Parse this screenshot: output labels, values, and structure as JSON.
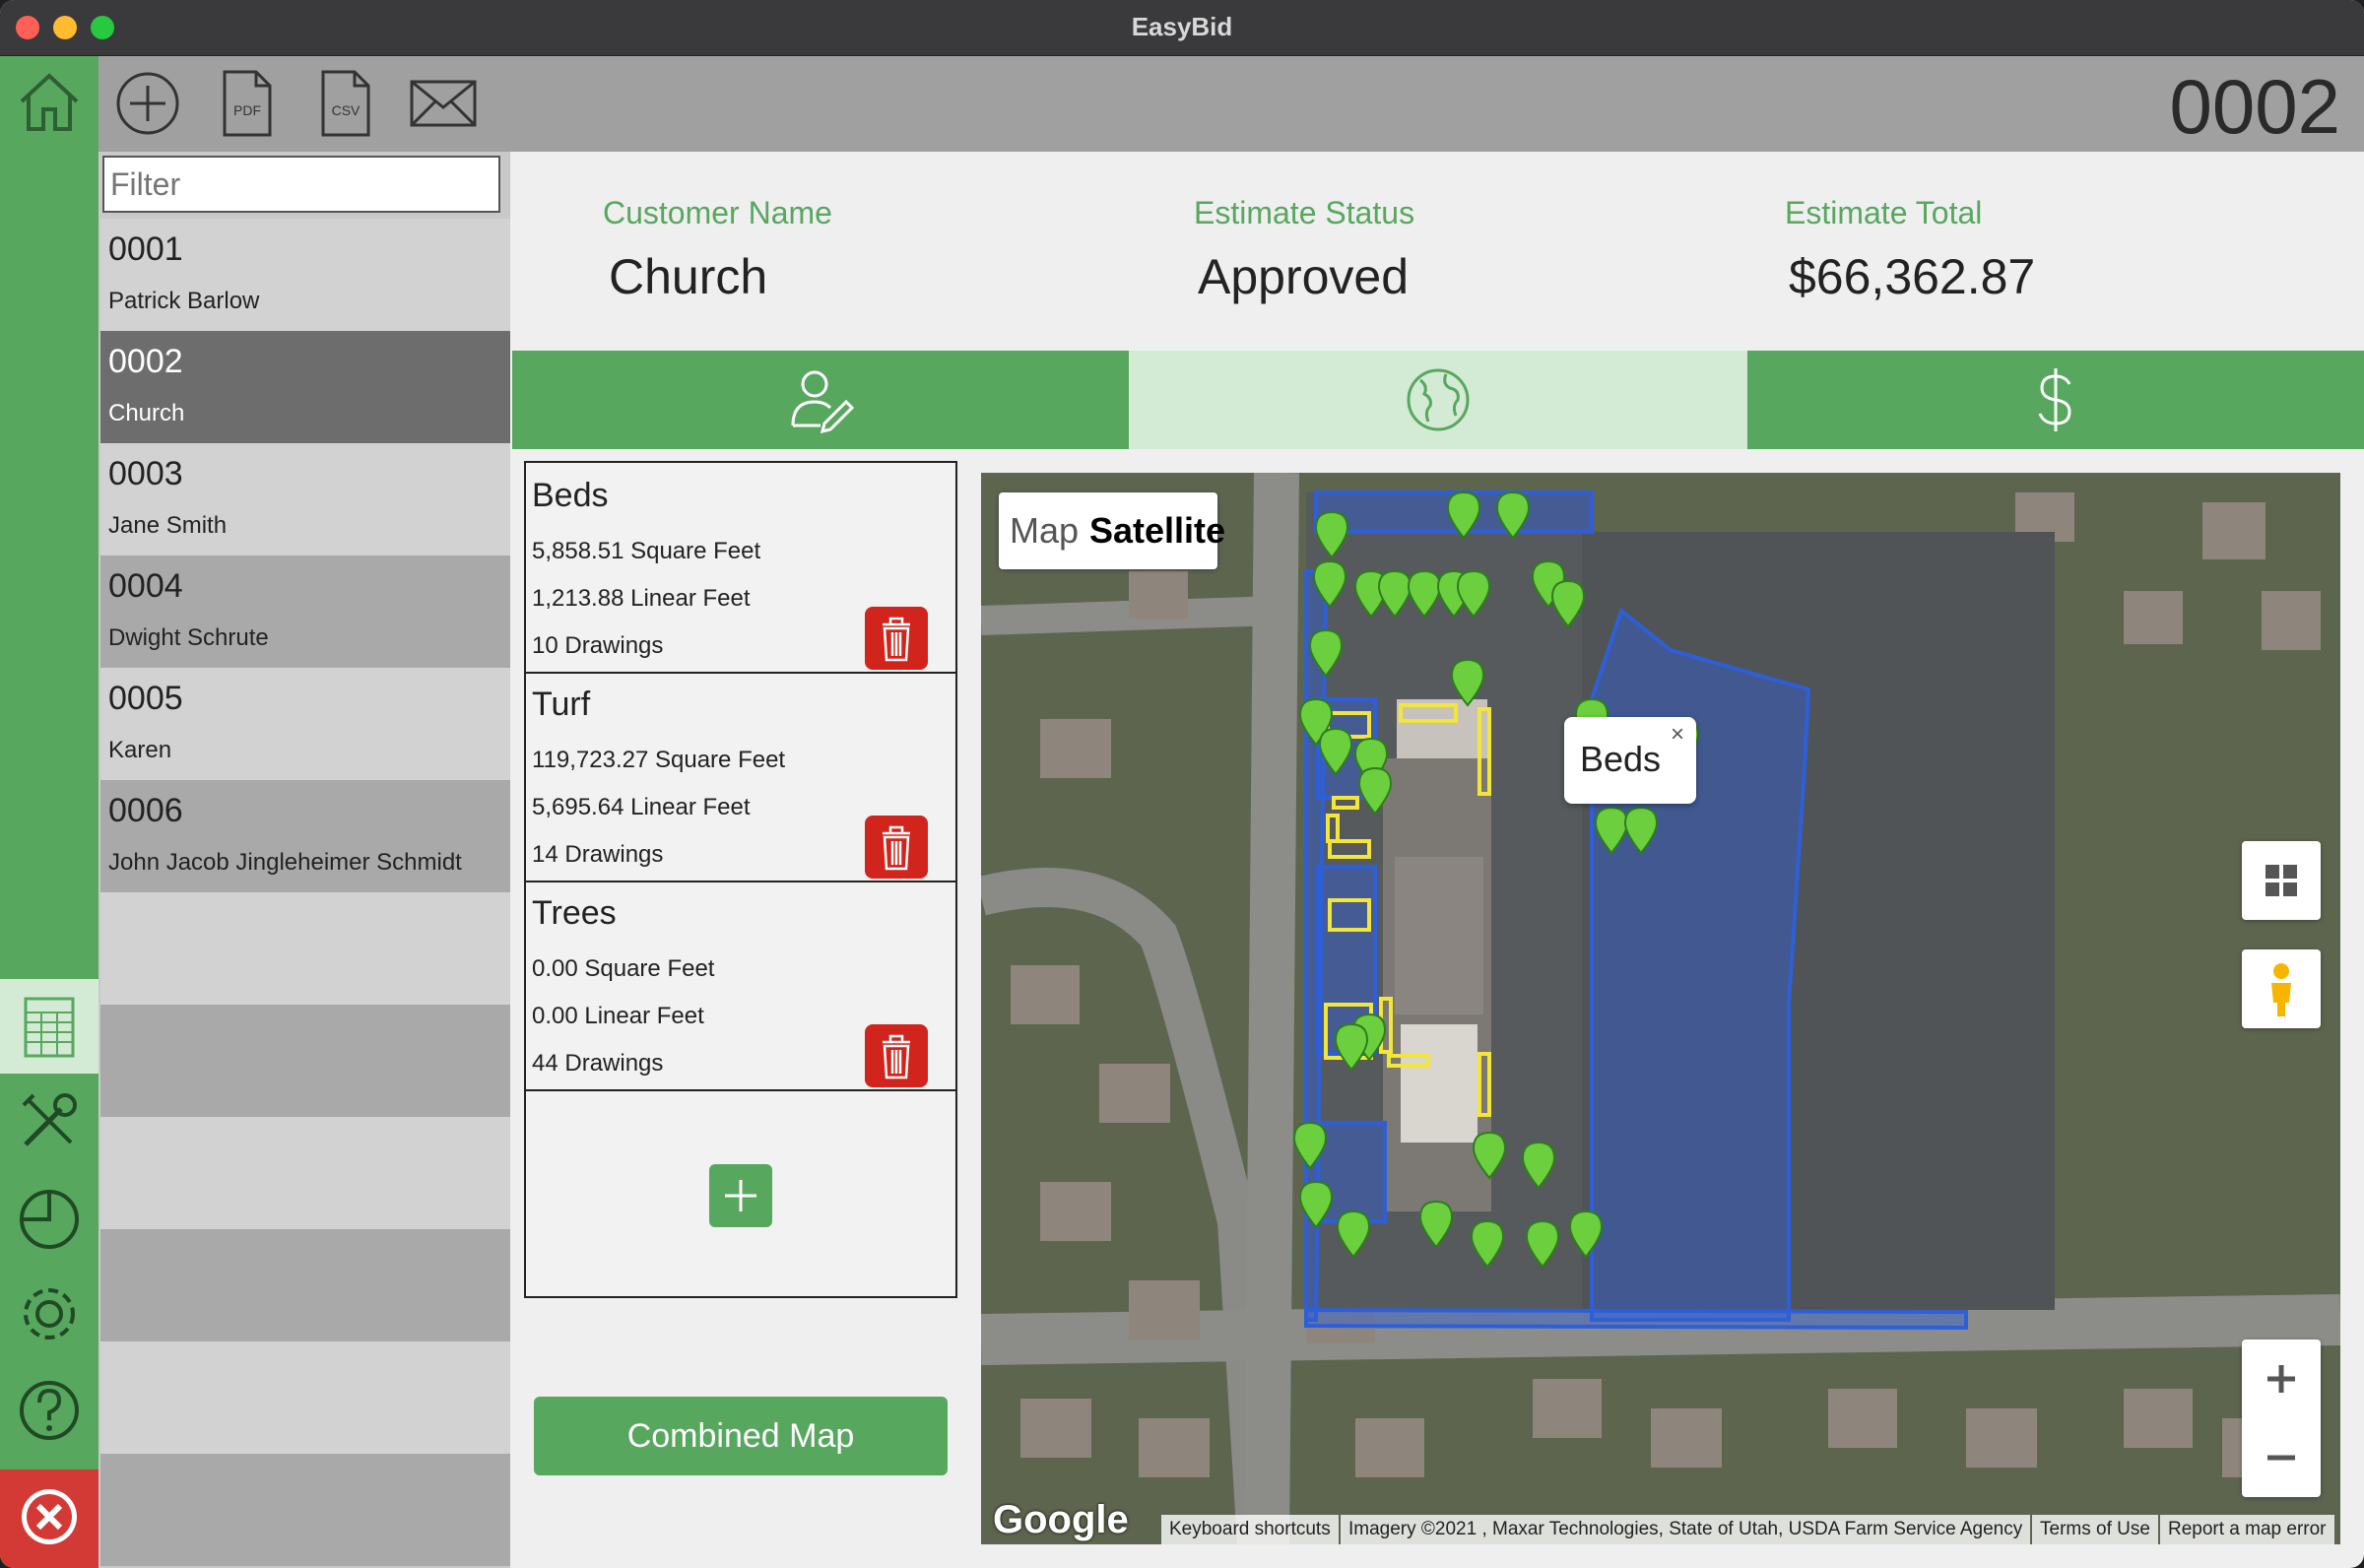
{
  "app": {
    "title": "EasyBid",
    "estimate_number": "0002"
  },
  "toolbar": {
    "icons": [
      "home-icon",
      "add-circle-icon",
      "pdf-icon",
      "csv-icon",
      "mail-icon"
    ],
    "pdf_label": "PDF",
    "csv_label": "CSV"
  },
  "filter": {
    "placeholder": "Filter"
  },
  "estimates": [
    {
      "number": "0001",
      "name": "Patrick Barlow"
    },
    {
      "number": "0002",
      "name": "Church"
    },
    {
      "number": "0003",
      "name": "Jane Smith"
    },
    {
      "number": "0004",
      "name": "Dwight Schrute"
    },
    {
      "number": "0005",
      "name": "Karen"
    },
    {
      "number": "0006",
      "name": "John Jacob Jingleheimer Schmidt"
    }
  ],
  "selected_estimate": "0002",
  "header": {
    "customer_label": "Customer Name",
    "customer_value": "Church",
    "status_label": "Estimate Status",
    "status_value": "Approved",
    "total_label": "Estimate Total",
    "total_value": "$66,362.87"
  },
  "tabs": [
    {
      "icon": "user-edit-icon",
      "active": false
    },
    {
      "icon": "globe-icon",
      "active": true
    },
    {
      "icon": "dollar-icon",
      "active": false
    }
  ],
  "areas": [
    {
      "title": "Beds",
      "square": "5,858.51 Square Feet",
      "linear": "1,213.88 Linear Feet",
      "drawings": "10 Drawings"
    },
    {
      "title": "Turf",
      "square": "119,723.27 Square Feet",
      "linear": "5,695.64 Linear Feet",
      "drawings": "14 Drawings"
    },
    {
      "title": "Trees",
      "square": "0.00 Square Feet",
      "linear": "0.00 Linear Feet",
      "drawings": "44 Drawings"
    }
  ],
  "combined_map_label": "Combined Map",
  "map": {
    "type_options": [
      "Map",
      "Satellite"
    ],
    "selected_type": "Satellite",
    "popup_label": "Beds",
    "popup_close": "×",
    "google_logo": "Google",
    "attribution": {
      "shortcuts": "Keyboard shortcuts",
      "imagery": "Imagery ©2021 , Maxar Technologies, State of Utah, USDA Farm Service Agency",
      "terms": "Terms of Use",
      "report": "Report a map error"
    },
    "colors": {
      "turf": "#2f5fd8",
      "beds": "#f2e63a",
      "tree_pin": "#6ccf3e"
    }
  },
  "sidebar_nav": [
    "spreadsheet-icon",
    "tools-icon",
    "pie-chart-icon",
    "gear-icon",
    "help-icon",
    "close-icon"
  ],
  "colors": {
    "brand_green": "#58a75f",
    "active_tab": "#d3ebd5",
    "delete_red": "#d0241c",
    "exit_red": "#d43a35"
  }
}
